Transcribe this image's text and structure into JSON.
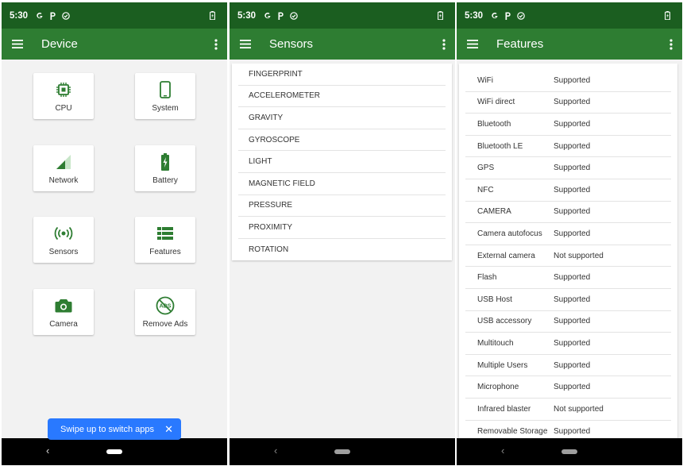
{
  "colors": {
    "status_bar": "#1b5e20",
    "app_bar": "#2e7d32",
    "icon_green": "#2e7d32",
    "toast": "#2979ff"
  },
  "status": {
    "time": "5:30",
    "icons": [
      "google-icon",
      "parking-icon",
      "check-circle-icon",
      "battery-icon"
    ]
  },
  "screens": {
    "device": {
      "title": "Device",
      "tiles": [
        {
          "label": "CPU",
          "icon": "chip-icon"
        },
        {
          "label": "System",
          "icon": "phone-icon"
        },
        {
          "label": "Network",
          "icon": "signal-icon"
        },
        {
          "label": "Battery",
          "icon": "battery-charging-icon"
        },
        {
          "label": "Sensors",
          "icon": "sensor-icon"
        },
        {
          "label": "Features",
          "icon": "list-icon"
        },
        {
          "label": "Camera",
          "icon": "camera-icon"
        },
        {
          "label": "Remove Ads",
          "icon": "no-ads-icon"
        }
      ],
      "toast": "Swipe up to switch apps"
    },
    "sensors": {
      "title": "Sensors",
      "items": [
        "FINGERPRINT",
        "ACCELEROMETER",
        "GRAVITY",
        "GYROSCOPE",
        "LIGHT",
        "MAGNETIC FIELD",
        "PRESSURE",
        "PROXIMITY",
        "ROTATION"
      ]
    },
    "features": {
      "title": "Features",
      "rows": [
        [
          "WiFi",
          "Supported"
        ],
        [
          "WiFi direct",
          "Supported"
        ],
        [
          "Bluetooth",
          "Supported"
        ],
        [
          "Bluetooth LE",
          "Supported"
        ],
        [
          "GPS",
          "Supported"
        ],
        [
          "NFC",
          "Supported"
        ],
        [
          "CAMERA",
          "Supported"
        ],
        [
          "Camera autofocus",
          "Supported"
        ],
        [
          "External camera",
          "Not supported"
        ],
        [
          "Flash",
          "Supported"
        ],
        [
          "USB Host",
          "Supported"
        ],
        [
          "USB accessory",
          "Supported"
        ],
        [
          "Multitouch",
          "Supported"
        ],
        [
          "Multiple Users",
          "Supported"
        ],
        [
          "Microphone",
          "Supported"
        ],
        [
          "Infrared blaster",
          "Not supported"
        ],
        [
          "Removable Storage",
          "Supported"
        ]
      ]
    }
  }
}
